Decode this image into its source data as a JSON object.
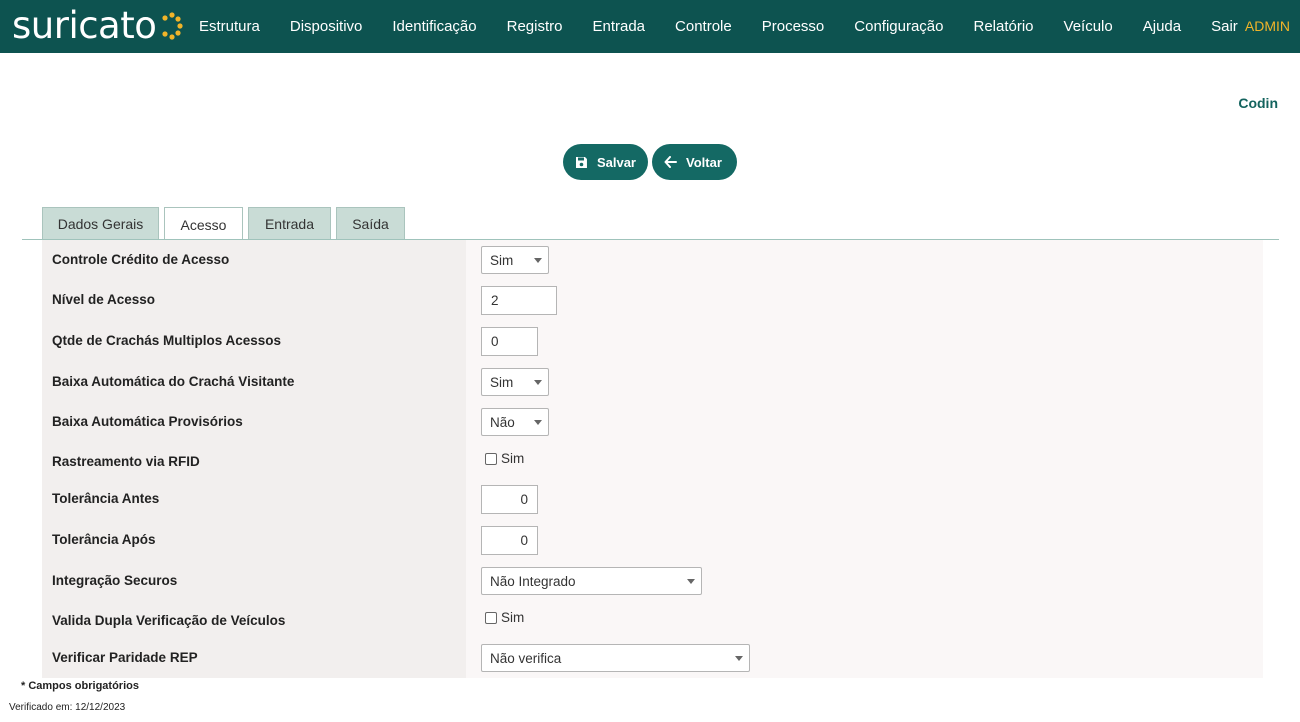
{
  "brand": {
    "name": "suricato",
    "accent": "#f0b429",
    "bar_color": "#0d5350"
  },
  "nav": {
    "items": [
      "Estrutura",
      "Dispositivo",
      "Identificação",
      "Registro",
      "Entrada",
      "Controle",
      "Processo",
      "Configuração",
      "Relatório",
      "Veículo",
      "Ajuda",
      "Sair"
    ],
    "user": "ADMIN"
  },
  "header": {
    "codin_label": "Codin"
  },
  "actions": {
    "save_label": "Salvar",
    "save_icon": "floppy-disk-icon",
    "back_label": "Voltar",
    "back_icon": "arrow-left-icon"
  },
  "tabs": [
    {
      "label": "Dados Gerais",
      "active": false
    },
    {
      "label": "Acesso",
      "active": true
    },
    {
      "label": "Entrada",
      "active": false
    },
    {
      "label": "Saída",
      "active": false
    }
  ],
  "form": {
    "controle_credito": {
      "label": "Controle Crédito de Acesso",
      "value": "Sim"
    },
    "nivel_acesso": {
      "label": "Nível de Acesso",
      "value": "2"
    },
    "qtde_crachas": {
      "label": "Qtde de Crachás Multiplos Acessos",
      "value": "0"
    },
    "baixa_visitante": {
      "label": "Baixa Automática do Crachá Visitante",
      "value": "Sim"
    },
    "baixa_provisorios": {
      "label": "Baixa Automática Provisórios",
      "value": "Não"
    },
    "rastreamento_rfid": {
      "label": "Rastreamento via RFID",
      "option": "Sim",
      "checked": false
    },
    "tolerancia_antes": {
      "label": "Tolerância Antes",
      "value": "0"
    },
    "tolerancia_apos": {
      "label": "Tolerância Após",
      "value": "0"
    },
    "integracao_securos": {
      "label": "Integração Securos",
      "value": "Não Integrado"
    },
    "dupla_verificacao": {
      "label": "Valida Dupla Verificação de Veículos",
      "option": "Sim",
      "checked": false
    },
    "paridade_rep": {
      "label": "Verificar Paridade REP",
      "value": "Não verifica"
    }
  },
  "footer": {
    "required_note": "* Campos obrigatórios",
    "verified": "Verificado em: 12/12/2023"
  }
}
